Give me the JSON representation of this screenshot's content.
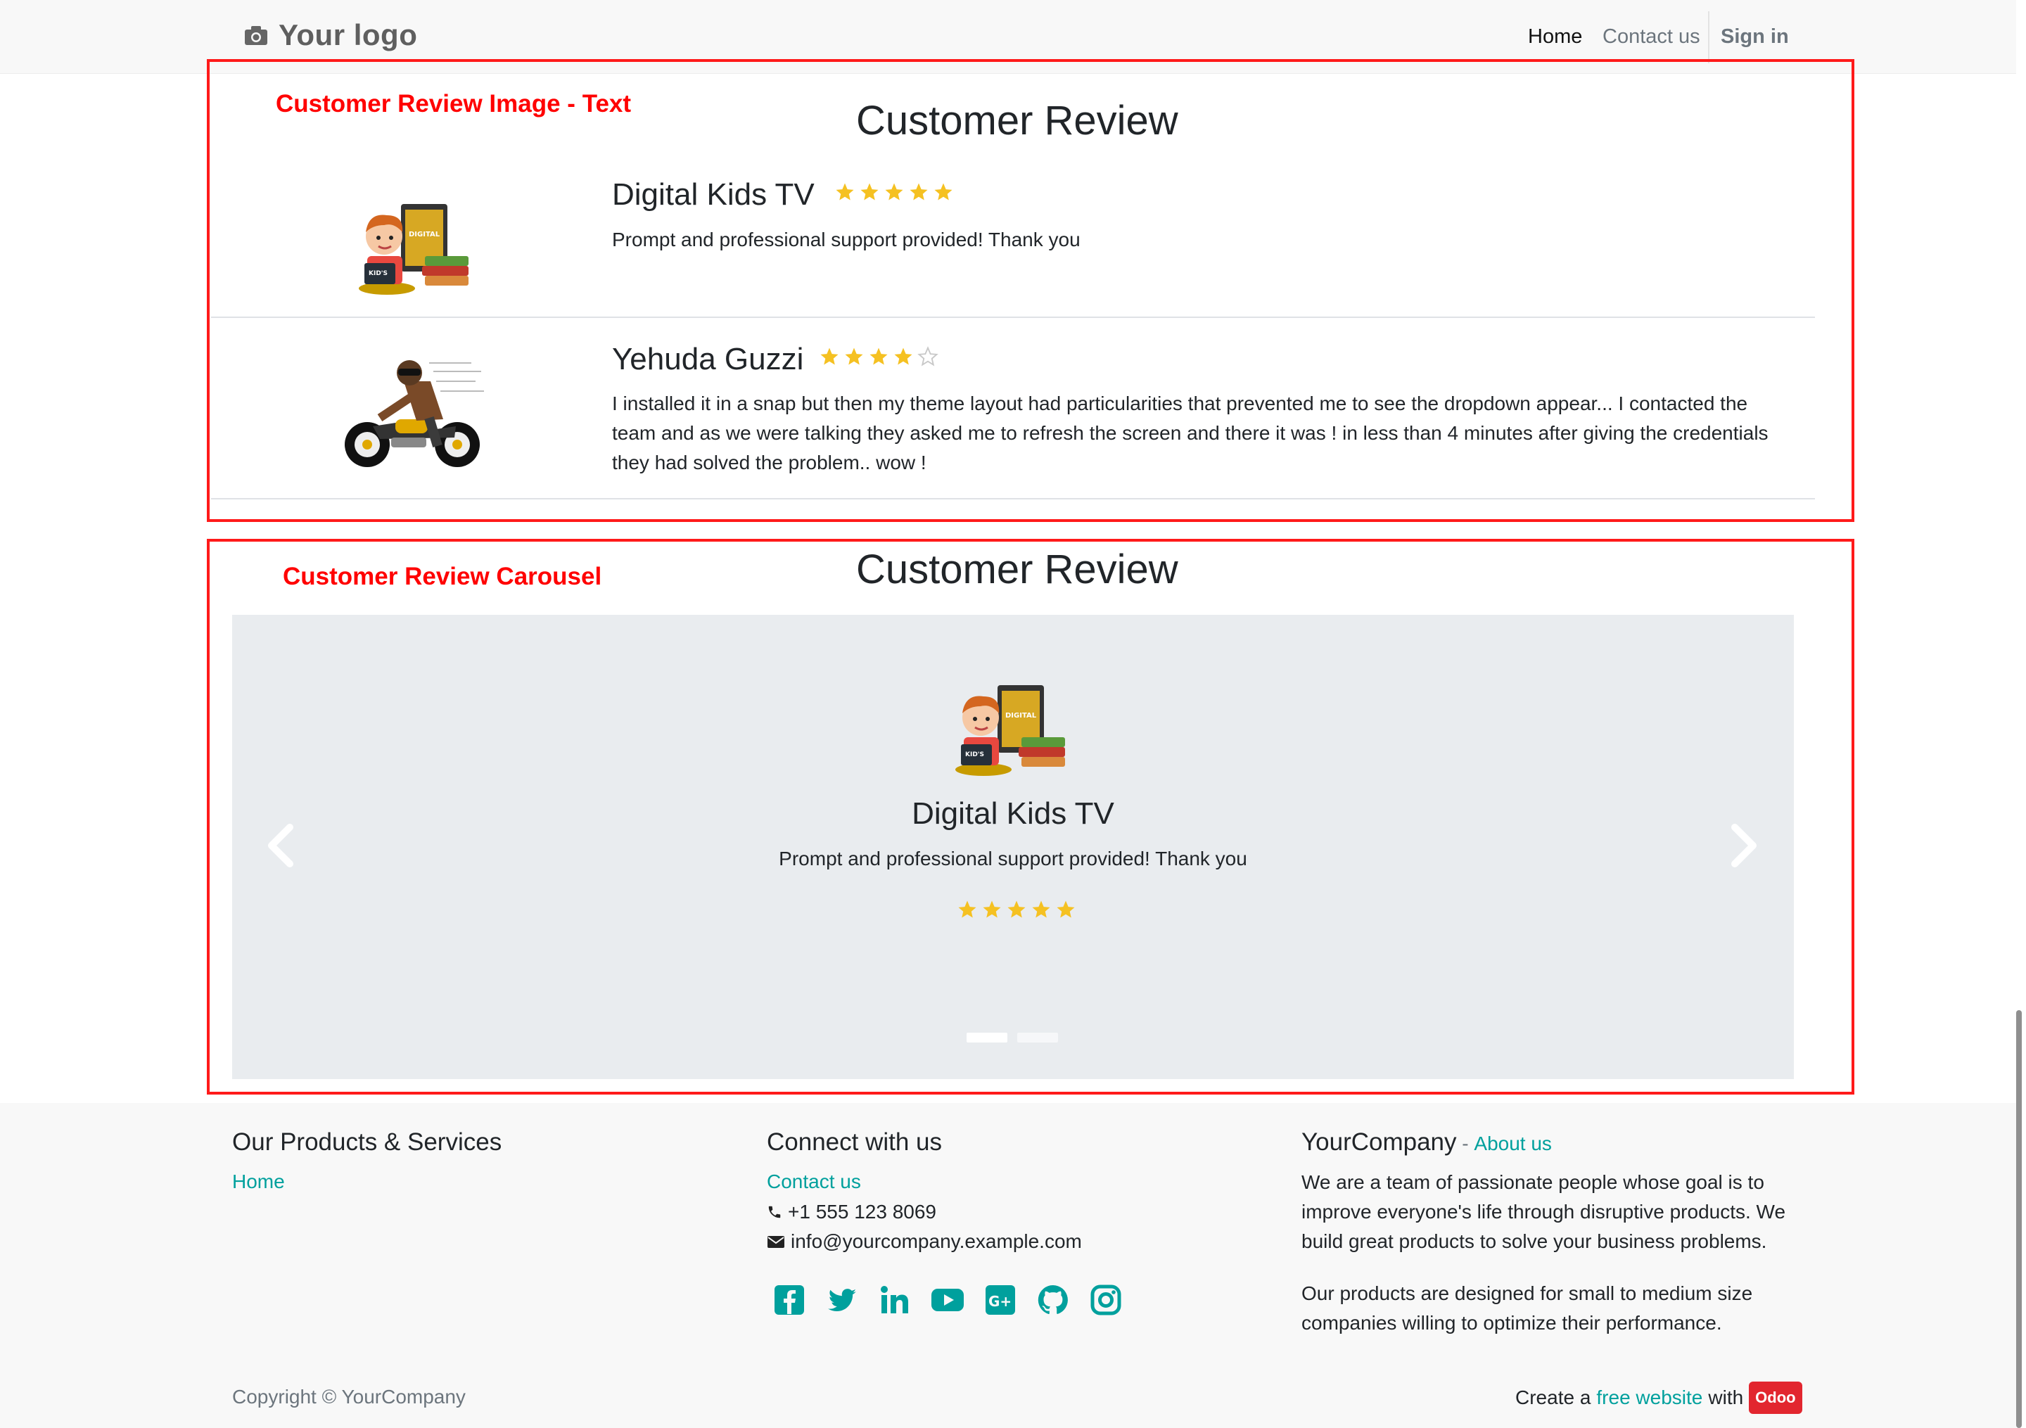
{
  "navbar": {
    "logo_text": "Your logo",
    "links": [
      {
        "label": "Home",
        "active": true
      },
      {
        "label": "Contact us",
        "active": false
      }
    ],
    "signin_label": "Sign in"
  },
  "annotations": {
    "frame1_label": "Customer Review Image - Text",
    "frame2_label": "Customer Review Carousel",
    "frame_color": "#ff0000"
  },
  "section1": {
    "title": "Customer Review",
    "reviews": [
      {
        "name": "Digital Kids TV",
        "rating": 5,
        "max_rating": 5,
        "text": "Prompt and professional support provided! Thank you",
        "image": "kids-tv-illustration"
      },
      {
        "name": "Yehuda Guzzi",
        "rating": 4,
        "max_rating": 5,
        "text": "I installed it in a snap but then my theme layout had particularities that prevented me to see the dropdown appear... I contacted the team and as we were talking they asked me to refresh the screen and there it was ! in less than 4 minutes after giving the credentials they had solved the problem.. wow !",
        "image": "motorcycle-rider-illustration"
      }
    ]
  },
  "section2": {
    "title": "Customer Review",
    "carousel": {
      "name": "Digital Kids TV",
      "text": "Prompt and professional support provided! Thank you",
      "rating": 5,
      "slides": 2,
      "active_slide": 1,
      "background": "#e9ecef"
    }
  },
  "footer": {
    "col1": {
      "heading": "Our Products & Services",
      "links": [
        "Home"
      ]
    },
    "col2": {
      "heading": "Connect with us",
      "link": "Contact us",
      "phone": "+1 555 123 8069",
      "email": "info@yourcompany.example.com",
      "social_icons": [
        "facebook-icon",
        "twitter-icon",
        "linkedin-icon",
        "youtube-icon",
        "google-plus-icon",
        "github-icon",
        "instagram-icon"
      ]
    },
    "col3": {
      "company": "YourCompany",
      "separator": " - ",
      "about_link": "About us",
      "para1": "We are a team of passionate people whose goal is to improve everyone's life through disruptive products. We build great products to solve your business problems.",
      "para2": "Our products are designed for small to medium size companies willing to optimize their performance."
    },
    "copyright": "Copyright © YourCompany",
    "create_prefix": "Create a",
    "create_link": "free website",
    "create_mid": "with",
    "odoo_badge": "Odoo",
    "accent_color": "#00a09d"
  },
  "colors": {
    "star": "#f5c122",
    "star_empty": "#c8c8c8",
    "brand_accent": "#00a09d"
  }
}
